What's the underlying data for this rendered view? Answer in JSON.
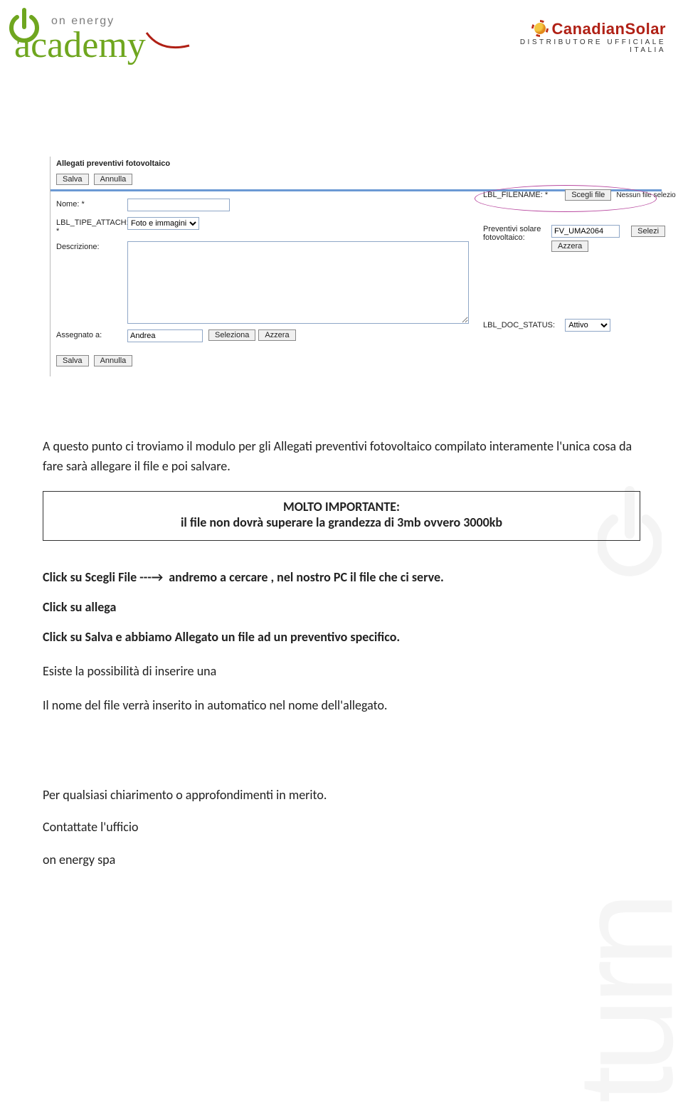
{
  "logos": {
    "left_top": "on energy",
    "left_script": "academy",
    "right_brand": "CanadianSolar",
    "right_sub": "DISTRIBUTORE UFFICIALE ITALIA"
  },
  "form": {
    "title": "Allegati preventivi fotovoltaico",
    "save": "Salva",
    "cancel": "Annulla",
    "name_label": "Nome: *",
    "name_value": "",
    "type_label": "LBL_TIPE_ATTACH: *",
    "type_value": "Foto e immagini",
    "desc_label": "Descrizione:",
    "desc_value": "",
    "assign_label": "Assegnato a:",
    "assign_value": "Andrea",
    "select_btn": "Seleziona",
    "reset_btn": "Azzera",
    "filename_label": "LBL_FILENAME: *",
    "browse_btn": "Scegli file",
    "browse_status": "Nessun file selezio",
    "prev_label": "Preventivi solare fotovoltaico:",
    "prev_value": "FV_UMA2064",
    "selezi_btn": "Selezi",
    "status_label": "LBL_DOC_STATUS:",
    "status_value": "Attivo"
  },
  "text": {
    "para": "A questo punto ci troviamo il modulo per gli Allegati preventivi fotovoltaico compilato interamente l'unica cosa da fare sarà allegare il file e poi salvare.",
    "notice_title": "MOLTO IMPORTANTE:",
    "notice_line": "il file non dovrà superare la grandezza di 3mb ovvero 3000kb",
    "b1a": "Click su Scegli File ---",
    "b1b": "andremo a cercare , nel nostro PC il file che ci serve.",
    "b2": "Click su allega",
    "b3": "Click su Salva e abbiamo Allegato un file ad un preventivo specifico.",
    "p2": "Esiste la possibilità di inserire una",
    "p3": "Il nome del file verrà inserito in automatico nel nome dell'allegato.",
    "p4": "Per qualsiasi chiarimento o approfondimenti in merito.",
    "p5": "Contattate l'ufficio",
    "p6": "on energy spa"
  },
  "watermark": "turn"
}
